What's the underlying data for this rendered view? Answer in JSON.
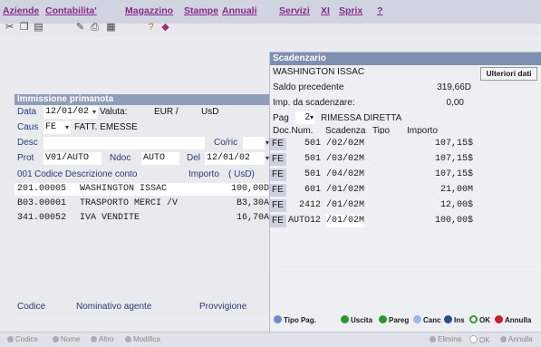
{
  "menu": {
    "items": [
      "Aziende",
      "Contabilita'",
      "Magazzino",
      "Stampe",
      "Annuali",
      "Servizi",
      "XI",
      "Sprix",
      "?"
    ]
  },
  "toolbar": {
    "icons": [
      "cut-icon",
      "copy-icon",
      "paste-icon",
      "edit-icon",
      "print-icon",
      "list-icon",
      "help-icon",
      "eraser-icon"
    ]
  },
  "primanota": {
    "title": "Immissione primanota",
    "data_label": "Data",
    "data_value": "12/01/02",
    "valuta_label": "Valuta:",
    "valuta_value": "EUR /",
    "valuta_code": "UsD",
    "caus_label": "Caus",
    "caus_value": "FE",
    "caus_desc": "FATT. EMESSE",
    "desc_label": "Desc",
    "desc_value": "",
    "cofric_label": "Co/ric",
    "cofric_value": "",
    "prot_label": "Prot",
    "prot_value": "V01/AUTO",
    "ndoc_label": "Ndoc",
    "ndoc_value": "AUTO",
    "del_label": "Del",
    "del_value": "12/01/02",
    "table_header": {
      "n": "001",
      "codice": "Codice Descrizione conto",
      "importo": "Importo",
      "valuta": "( UsD)"
    },
    "rows": [
      {
        "code": "201.00005",
        "desc": "WASHINGTON ISSAC",
        "amount": "100,00D"
      },
      {
        "code": "B03.00001",
        "desc": "TRASPORTO MERCI /V",
        "amount": "B3,30A"
      },
      {
        "code": "341.00052",
        "desc": "IVA VENDITE",
        "amount": "16,70A"
      }
    ],
    "footer": {
      "codice": "Codice",
      "nominativo": "Nominativo agente",
      "provvigione": "Provvigione"
    }
  },
  "scadenzario": {
    "title": "Scadenzario",
    "name": "WASHINGTON ISSAC",
    "more_button": "Ulteriori dati",
    "saldo_label": "Saldo precedente",
    "saldo_value": "319,66D",
    "imp_label": "Imp. da scadenzare:",
    "imp_value": "0,00",
    "pag_label": "Pag",
    "pag_code": "2",
    "pag_desc": "RIMESSA DIRETTA",
    "grid_header": {
      "doc": "Doc.Num.",
      "scadenza": "Scadenza",
      "tipo": "Tipo",
      "importo": "Importo"
    },
    "grid_rows": [
      {
        "doc": "FE",
        "num": "501",
        "scad": "/02/02M",
        "importo": "107,15$"
      },
      {
        "doc": "FE",
        "num": "501",
        "scad": "/03/02M",
        "importo": "107,15$"
      },
      {
        "doc": "FE",
        "num": "501",
        "scad": "/04/02M",
        "importo": "107,15$"
      },
      {
        "doc": "FE",
        "num": "601",
        "scad": "/01/02M",
        "importo": "21,00M"
      },
      {
        "doc": "FE",
        "num": "2412",
        "scad": "/01/02M",
        "importo": "12,00$"
      },
      {
        "doc": "FE",
        "num": "AUTO12",
        "scad": "/01/02M",
        "importo": "100,00$"
      }
    ],
    "buttons": {
      "tipo_pag": "Tipo Pag.",
      "uscita": "Uscita",
      "pareg": "Pareg",
      "canc": "Canc",
      "ins": "Ins",
      "ok": "OK",
      "annulla": "Annulla"
    }
  },
  "statusbar": {
    "codice": "Codice",
    "nome": "Nome",
    "altro": "Altro",
    "modifica": "Modifica",
    "elimina": "Elimina",
    "ok": "OK",
    "annulla": "Annulla"
  },
  "colors": {
    "menu_text": "#8a2a8a",
    "panel_title": "#8f9dbb",
    "label": "#2a3a7a",
    "green": "#2a9a2a",
    "red": "#cc2222",
    "blue": "#2a4aa0"
  }
}
